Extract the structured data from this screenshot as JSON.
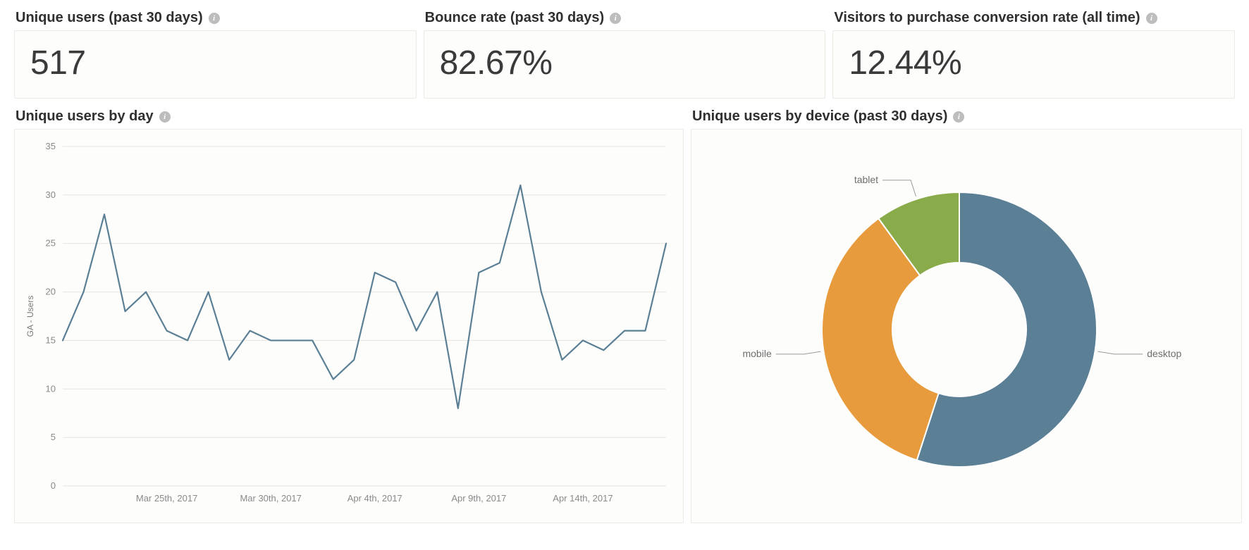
{
  "metrics": [
    {
      "title": "Unique users (past 30 days)",
      "value": "517"
    },
    {
      "title": "Bounce rate (past 30 days)",
      "value": "82.67%"
    },
    {
      "title": "Visitors to purchase conversion rate (all time)",
      "value": "12.44%"
    }
  ],
  "line_chart": {
    "title": "Unique users by day",
    "y_axis_title": "GA - Users"
  },
  "donut_chart": {
    "title": "Unique users by device (past 30 days)"
  },
  "info_glyph": "i",
  "chart_data": [
    {
      "type": "line",
      "title": "Unique users by day",
      "ylabel": "GA - Users",
      "xlabel": "",
      "ylim": [
        0,
        35
      ],
      "y_ticks": [
        0,
        5,
        10,
        15,
        20,
        25,
        30,
        35
      ],
      "x_tick_labels": [
        "Mar 25th, 2017",
        "Mar 30th, 2017",
        "Apr 4th, 2017",
        "Apr 9th, 2017",
        "Apr 14th, 2017"
      ],
      "x_tick_indices": [
        5,
        10,
        15,
        20,
        25
      ],
      "categories": [
        "Mar 20th, 2017",
        "Mar 21st, 2017",
        "Mar 22nd, 2017",
        "Mar 23rd, 2017",
        "Mar 24th, 2017",
        "Mar 25th, 2017",
        "Mar 26th, 2017",
        "Mar 27th, 2017",
        "Mar 28th, 2017",
        "Mar 29th, 2017",
        "Mar 30th, 2017",
        "Mar 31st, 2017",
        "Apr 1st, 2017",
        "Apr 2nd, 2017",
        "Apr 3rd, 2017",
        "Apr 4th, 2017",
        "Apr 5th, 2017",
        "Apr 6th, 2017",
        "Apr 7th, 2017",
        "Apr 8th, 2017",
        "Apr 9th, 2017",
        "Apr 10th, 2017",
        "Apr 11th, 2017",
        "Apr 12th, 2017",
        "Apr 13th, 2017",
        "Apr 14th, 2017",
        "Apr 15th, 2017",
        "Apr 16th, 2017",
        "Apr 17th, 2017",
        "Apr 18th, 2017"
      ],
      "values": [
        15,
        20,
        28,
        18,
        20,
        16,
        15,
        20,
        13,
        16,
        15,
        15,
        15,
        11,
        13,
        22,
        21,
        16,
        20,
        8,
        22,
        23,
        31,
        20,
        13,
        15,
        14,
        16,
        16,
        25
      ],
      "series_color": "#5b7f95"
    },
    {
      "type": "pie",
      "title": "Unique users by device (past 30 days)",
      "subtype": "donut",
      "series": [
        {
          "name": "desktop",
          "value": 55,
          "color": "#5b7f95"
        },
        {
          "name": "mobile",
          "value": 35,
          "color": "#e79b3c"
        },
        {
          "name": "tablet",
          "value": 10,
          "color": "#8aab4a"
        }
      ]
    }
  ]
}
